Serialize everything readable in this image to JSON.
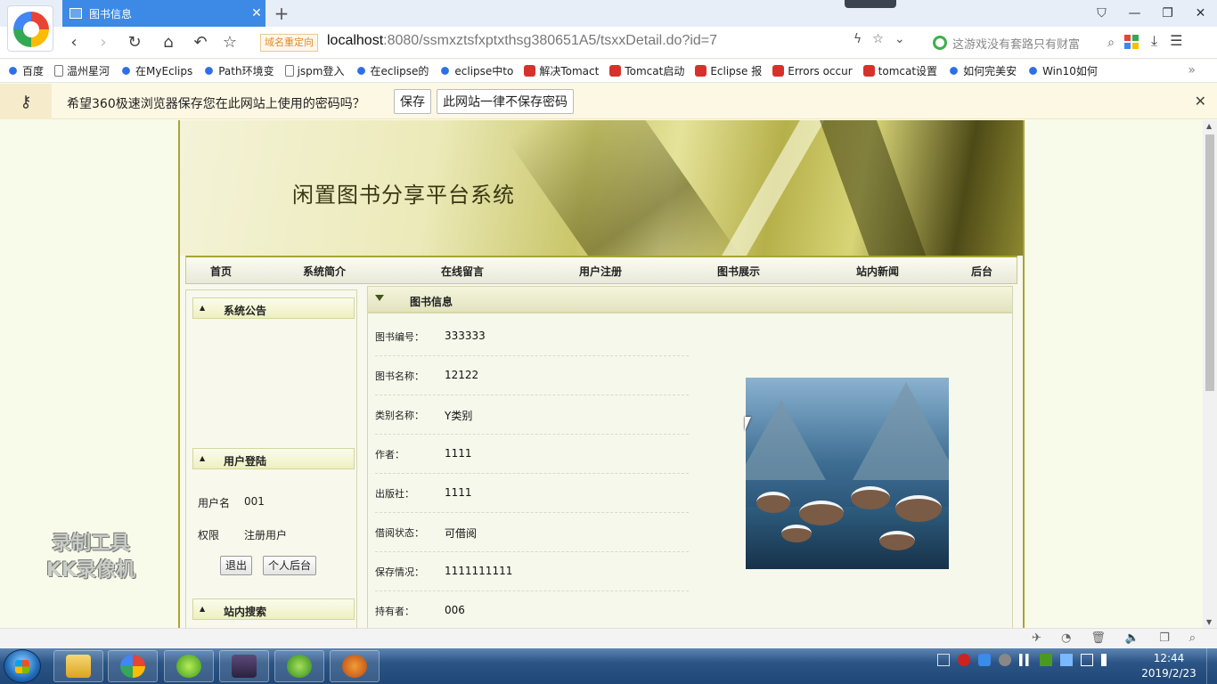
{
  "browser": {
    "tab_title": "图书信息",
    "tab_close": "✕",
    "new_tab": "+",
    "redirect_tag": "域名重定向",
    "url_host": "localhost",
    "url_rest": ":8080/ssmxztsfxptxthsg380651A5/tsxxDetail.do?id=7",
    "search_placeholder": "这游戏没有套路只有财富",
    "bookmarks": [
      {
        "label": "百度",
        "icon": "paw"
      },
      {
        "label": "温州星河",
        "icon": "doc"
      },
      {
        "label": "在MyEclips",
        "icon": "paw"
      },
      {
        "label": "Path环境变",
        "icon": "paw"
      },
      {
        "label": "jspm登入",
        "icon": "doc"
      },
      {
        "label": "在eclipse的",
        "icon": "paw"
      },
      {
        "label": "eclipse中to",
        "icon": "paw"
      },
      {
        "label": "解决Tomact",
        "icon": "csdn"
      },
      {
        "label": "Tomcat启动",
        "icon": "csdn"
      },
      {
        "label": "Eclipse 报",
        "icon": "csdn"
      },
      {
        "label": "Errors occur",
        "icon": "csdn"
      },
      {
        "label": "tomcat设置",
        "icon": "csdn"
      },
      {
        "label": "如何完美安",
        "icon": "paw"
      },
      {
        "label": "Win10如何",
        "icon": "paw"
      }
    ],
    "bookmarks_more": "»"
  },
  "password_bar": {
    "message": "希望360极速浏览器保存您在此网站上使用的密码吗？",
    "save_label": "保存",
    "never_label": "此网站一律不保存密码",
    "close": "✕"
  },
  "site": {
    "title": "闲置图书分享平台系统",
    "menu": [
      "首页",
      "系统简介",
      "在线留言",
      "用户注册",
      "图书展示",
      "站内新闻",
      "后台"
    ],
    "sidebar": {
      "notice_title": "系统公告",
      "login_title": "用户登陆",
      "username_label": "用户名",
      "username_value": "001",
      "role_label": "权限",
      "role_value": "注册用户",
      "logout_label": "退出",
      "personal_label": "个人后台",
      "search_title": "站内搜索"
    },
    "detail": {
      "title": "图书信息",
      "fields": [
        {
          "label": "图书编号：",
          "value": "333333"
        },
        {
          "label": "图书名称：",
          "value": "12122"
        },
        {
          "label": "类别名称：",
          "value": "Y类别"
        },
        {
          "label": "作者：",
          "value": "1111"
        },
        {
          "label": "出版社：",
          "value": "1111"
        },
        {
          "label": "借阅状态：",
          "value": "可借阅"
        },
        {
          "label": "保存情况：",
          "value": "1111111111"
        },
        {
          "label": "持有者：",
          "value": "006"
        }
      ]
    }
  },
  "watermark": [
    "录制工具",
    "KK录像机"
  ],
  "taskbar": {
    "time": "12:44",
    "date": "2019/2/23"
  }
}
